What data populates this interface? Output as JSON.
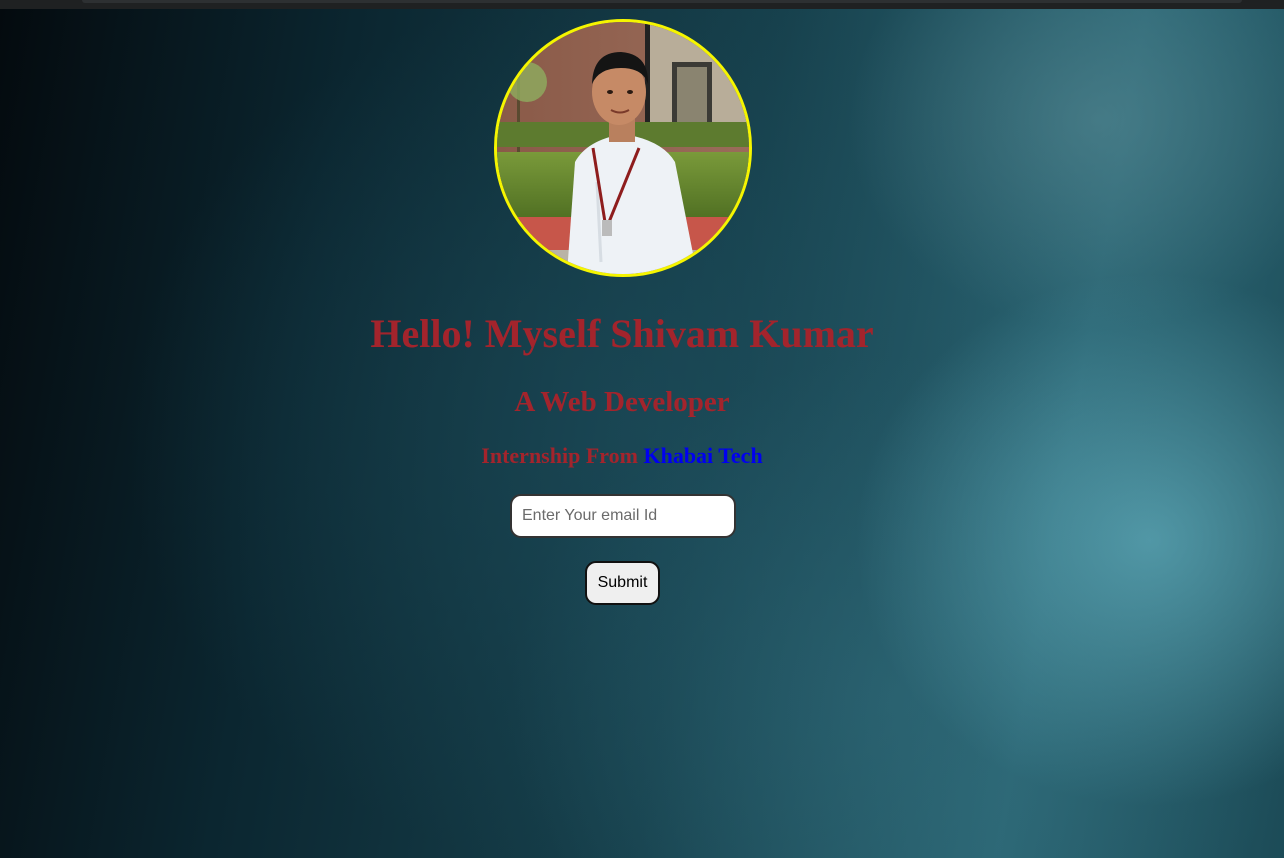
{
  "profile": {
    "heading": "Hello! Myself Shivam Kumar",
    "subheading": "A Web Developer",
    "internship_prefix": "Internship From ",
    "internship_company": "Khabai Tech"
  },
  "form": {
    "email_placeholder": "Enter Your email Id",
    "email_value": "",
    "submit_label": "Submit"
  },
  "colors": {
    "heading": "#a3242c",
    "company_link": "#0000f0",
    "avatar_border": "#f5f500"
  }
}
